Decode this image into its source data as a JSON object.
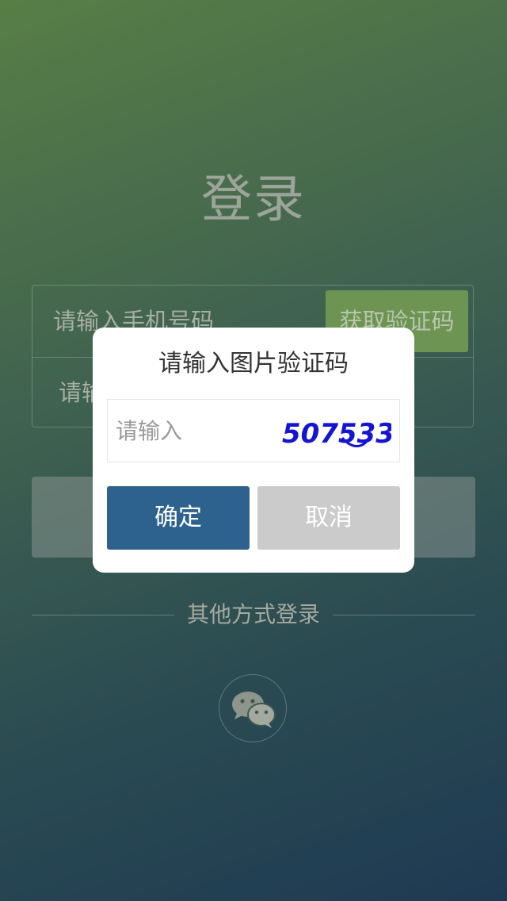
{
  "page": {
    "title": "登录"
  },
  "form": {
    "phone_placeholder": "请输入手机号码",
    "code_placeholder": "请输入验证码",
    "sms_button": "获取验证码"
  },
  "login_button": {
    "label": ""
  },
  "other_login": {
    "label": "其他方式登录",
    "wechat_icon": "wechat-icon"
  },
  "dialog": {
    "title": "请输入图片验证码",
    "input_placeholder": "请输入",
    "captcha_text": "507533",
    "confirm_label": "确定",
    "cancel_label": "取消"
  },
  "colors": {
    "confirm_button": "#2d628f",
    "cancel_button": "#cbcbcb",
    "captcha_text": "#1414d2",
    "sms_button": "#6e9453"
  }
}
